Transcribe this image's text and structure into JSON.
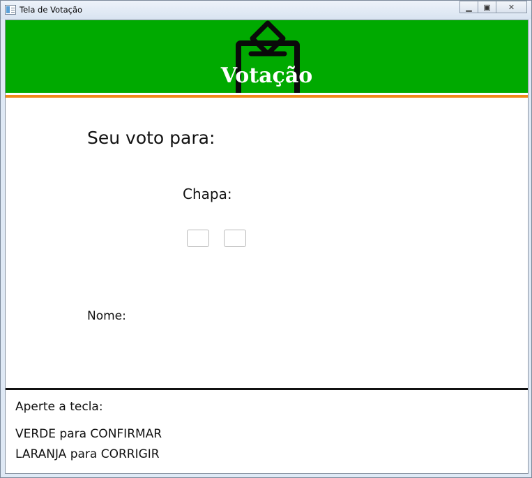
{
  "window": {
    "title": "Tela de Votação",
    "minimize_label": "▁",
    "maximize_label": "▣",
    "close_label": "✕"
  },
  "banner": {
    "title": "Votação",
    "background_color": "#00aa00",
    "stripe_color": "#f08a1a",
    "icon": "ballot-box-icon"
  },
  "form": {
    "heading": "Seu voto para:",
    "chapa_label": "Chapa:",
    "digits": [
      "",
      ""
    ],
    "nome_label": "Nome:"
  },
  "instructions": {
    "intro": "Aperte a tecla:",
    "confirm": "VERDE para CONFIRMAR",
    "correct": "LARANJA para CORRIGIR"
  }
}
